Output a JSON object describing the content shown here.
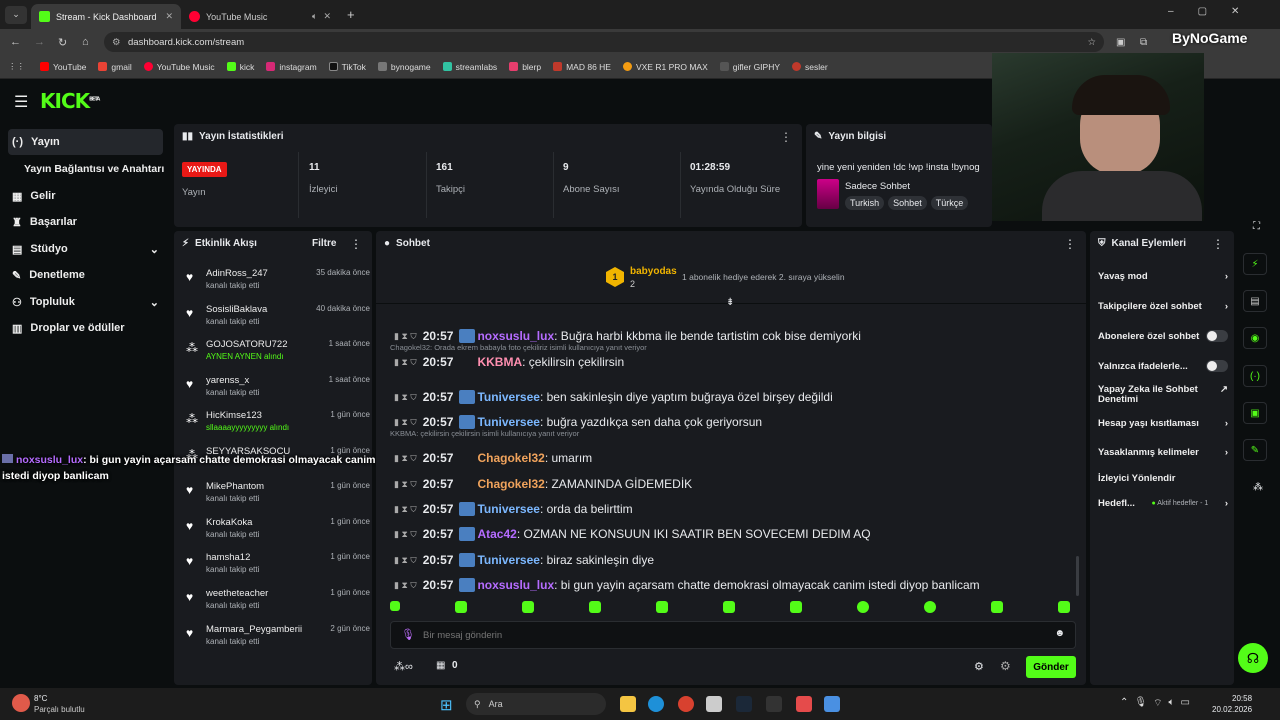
{
  "browser": {
    "tabs": [
      {
        "title": "Stream - Kick Dashboard"
      },
      {
        "title": "YouTube Music"
      }
    ],
    "url": "dashboard.kick.com/stream",
    "bookmarks": [
      "YouTube",
      "gmail",
      "YouTube Music",
      "kick",
      "instagram",
      "TikTok",
      "bynogame",
      "streamlabs",
      "blerp",
      "MAD 86 HE",
      "VXE R1 PRO MAX",
      "gifler GIPHY",
      "sesler"
    ]
  },
  "overlay": {
    "watermark": "ByNoGame",
    "alert_user": "noxsuslu_lux",
    "alert_text": ": bi gun yayin açarsam chatte demokrasi olmayacak canim istedi diyop banlicam"
  },
  "sidebar": {
    "items": [
      "Yayın",
      "Yayın Bağlantısı ve Anahtarı",
      "Gelir",
      "Başarılar",
      "Stüdyo",
      "Denetleme",
      "Topluluk",
      "Droplar ve ödüller"
    ]
  },
  "stats": {
    "title": "Yayın İstatistikleri",
    "live_badge": "YAYINDA",
    "live_label": "Yayın",
    "items": [
      {
        "value": "11",
        "label": "İzleyici"
      },
      {
        "value": "161",
        "label": "Takipçi"
      },
      {
        "value": "9",
        "label": "Abone Sayısı"
      },
      {
        "value": "01:28:59",
        "label": "Yayında Olduğu Süre"
      }
    ]
  },
  "info": {
    "title": "Yayın bilgisi",
    "stream_title": "yine yeni yeniden !dc !wp !insta !bynog",
    "category": "Sadece Sohbet",
    "tags": [
      "Turkish",
      "Sohbet",
      "Türkçe"
    ]
  },
  "activity": {
    "title": "Etkinlik Akışı",
    "filter": "Filtre",
    "items": [
      {
        "name": "AdinRoss_247",
        "sub": "kanalı takip etti",
        "time": "35 dakika önce"
      },
      {
        "name": "SosisliBaklava",
        "sub": "kanalı takip etti",
        "time": "40 dakika önce"
      },
      {
        "name": "GOJOSATORU722",
        "sub": "AYNEN AYNEN alındı",
        "time": "1 saat önce"
      },
      {
        "name": "yarenss_x",
        "sub": "kanalı takip etti",
        "time": "1 saat önce"
      },
      {
        "name": "HicKimse123",
        "sub": "sllaaaayyyyyyyyy alındı",
        "time": "1 gün önce"
      },
      {
        "name": "SEYYARSAKSOCU",
        "sub": "",
        "time": "1 gün önce"
      },
      {
        "name": "MikePhantom",
        "sub": "kanalı takip etti",
        "time": "1 gün önce"
      },
      {
        "name": "KrokaKoka",
        "sub": "kanalı takip etti",
        "time": "1 gün önce"
      },
      {
        "name": "hamsha12",
        "sub": "kanalı takip etti",
        "time": "1 gün önce"
      },
      {
        "name": "weetheteacher",
        "sub": "kanalı takip etti",
        "time": "1 gün önce"
      },
      {
        "name": "Marmara_Peygamberii",
        "sub": "kanalı takip etti",
        "time": "2 gün önce"
      }
    ]
  },
  "chat": {
    "title": "Sohbet",
    "pinned_user": "babyodas",
    "pinned_count": "2",
    "pinned_rank": "1",
    "pinned_text": "1 abonelik hediye ederek 2. sıraya yükselin",
    "messages": [
      {
        "time": "20:57",
        "user": "noxsuslu_lux",
        "color": "#b56cff",
        "text": ": Buğra harbi kkbma ile bende tartistim cok bise demiyorki",
        "reply": ""
      },
      {
        "time": "20:57",
        "user": "KKBMA",
        "color": "#ff8fb0",
        "text": ": çekilirsin çekilirsin",
        "reply": "Chagokel32: Orada ekrem babayla foto çekiliriz isimli kullanıcıya yanıt veriyor"
      },
      {
        "time": "20:57",
        "user": "Tuniversee",
        "color": "#7cb8ff",
        "text": ": ben sakinleşin diye yaptım buğraya özel birşey değildi",
        "reply": ""
      },
      {
        "time": "20:57",
        "user": "Tuniversee",
        "color": "#7cb8ff",
        "text": ": buğra yazdıkça sen daha çok geriyorsun",
        "reply": ""
      },
      {
        "time": "20:57",
        "user": "Chagokel32",
        "color": "#f0a35c",
        "text": ": umarım",
        "reply": "KKBMA: çekilirsin çekilirsin isimli kullanıcıya yanıt veriyor"
      },
      {
        "time": "20:57",
        "user": "Chagokel32",
        "color": "#f0a35c",
        "text": ": ZAMANINDA GİDEMEDİK",
        "reply": ""
      },
      {
        "time": "20:57",
        "user": "Tuniversee",
        "color": "#7cb8ff",
        "text": ": orda da belirttim",
        "reply": ""
      },
      {
        "time": "20:57",
        "user": "Atac42",
        "color": "#b56cff",
        "text": ": OZMAN NE KONSUUN IKI SAATIR BEN SOVECEMI DEDIM AQ",
        "reply": ""
      },
      {
        "time": "20:57",
        "user": "Tuniversee",
        "color": "#7cb8ff",
        "text": ": biraz sakinleşin diye",
        "reply": ""
      },
      {
        "time": "20:57",
        "user": "noxsuslu_lux",
        "color": "#b56cff",
        "text": ": bi gun yayin açarsam chatte demokrasi olmayacak canim istedi diyop banlicam",
        "reply": ""
      }
    ],
    "input_placeholder": "Bir mesaj gönderin",
    "points": "0",
    "send": "Gönder"
  },
  "channel_actions": {
    "title": "Kanal Eylemleri",
    "items": [
      "Yavaş mod",
      "Takipçilere özel sohbet",
      "Abonelere özel sohbet",
      "Yalnızca ifadelerle...",
      "Yapay Zeka ile Sohbet Denetimi",
      "Hesap yaşı kısıtlaması",
      "Yasaklanmış kelimeler",
      "İzleyici Yönlendir",
      "Hedefl..."
    ],
    "goal_status": "Aktif hedefler - 1"
  },
  "taskbar": {
    "temp": "8°C",
    "weather": "Parçalı bulutlu",
    "search": "Ara",
    "time": "20:58",
    "date": "20.02.2026"
  },
  "colors": {
    "accent": "#53fc18",
    "live": "#e91916"
  }
}
